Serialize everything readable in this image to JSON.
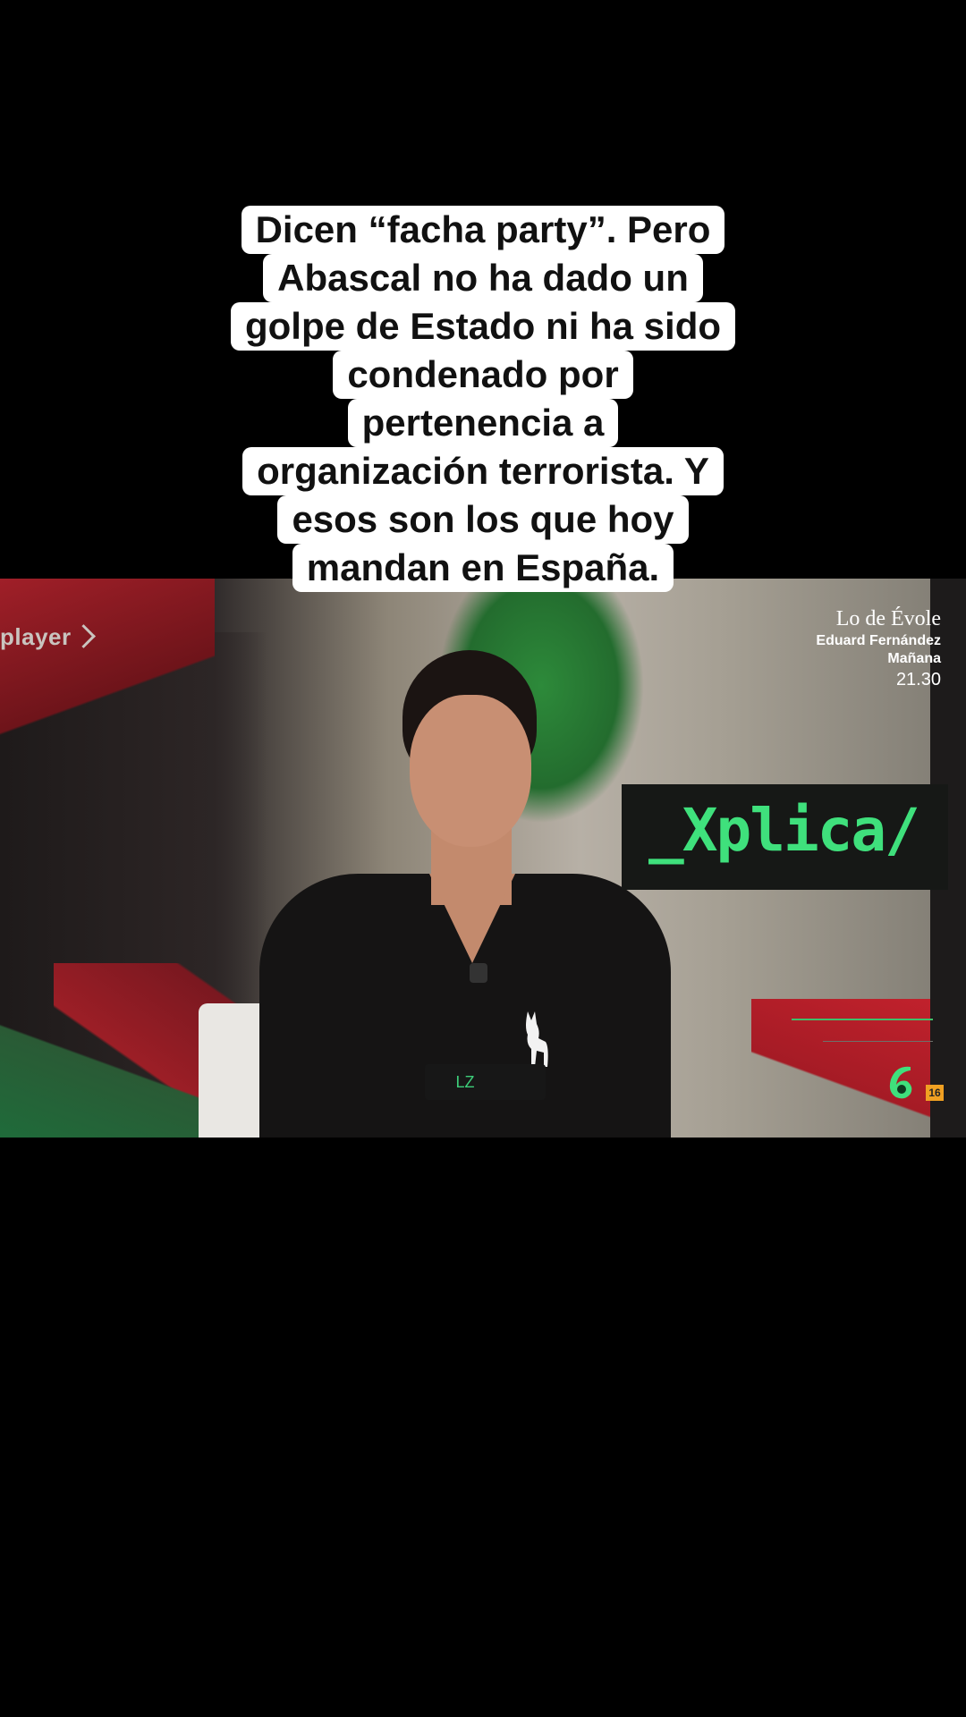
{
  "caption": {
    "lines": [
      "Dicen “facha party”. Pero",
      "Abascal no ha dado un",
      "golpe de Estado ni ha sido",
      "condenado por",
      "pertenencia a",
      "organización terrorista. Y",
      "esos son los que hoy",
      "mandan en España."
    ]
  },
  "video": {
    "player_logo": "player",
    "promo": {
      "show": "Lo de Évole",
      "guest": "Eduard Fernández",
      "day": "Mañana",
      "time": "21.30"
    },
    "program_title": "_Xplica/",
    "lower_third": "LZ",
    "channel_logo": "6",
    "age_rating": "16",
    "colors": {
      "program_green": "#3fe07c",
      "channel_green": "#3fe07c",
      "rating_orange": "#f0a022"
    }
  }
}
